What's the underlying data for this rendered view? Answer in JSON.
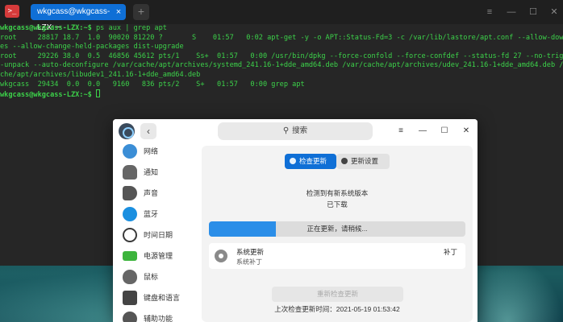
{
  "terminal": {
    "app_icon": "terminal-icon",
    "tab_title": "wkgcass@wkgcass-LZX: ~",
    "tab_close": "×",
    "new_tab": "+",
    "controls": [
      "≡",
      "—",
      "☐",
      "✕"
    ],
    "lines": [
      {
        "prompt": "wkgcass@wkgcass-LZX:~$",
        "text": " ps aux | grep apt"
      },
      {
        "prompt": "",
        "text": "root     28817 18.7  1.0  90020 81220 ?       S    01:57   0:02 apt-get -y -o APT::Status-Fd=3 -c /var/lib/lastore/apt.conf --allow-downgrad"
      },
      {
        "prompt": "",
        "text": "es --allow-change-held-packages dist-upgrade"
      },
      {
        "prompt": "",
        "text": "root     29226 38.0  0.5  46856 45612 pts/1    Ss+  01:57   0:00 /usr/bin/dpkg --force-confold --force-confdef --status-fd 27 --no-triggers -"
      },
      {
        "prompt": "",
        "text": "-unpack --auto-deconfigure /var/cache/apt/archives/systemd_241.16-1+dde_amd64.deb /var/cache/apt/archives/udev_241.16-1+dde_amd64.deb /var/ca"
      },
      {
        "prompt": "",
        "text": "che/apt/archives/libudev1_241.16-1+dde_amd64.deb"
      },
      {
        "prompt": "",
        "text": "wkgcass  29434  0.0  0.0   9160   836 pts/2    S+   01:57   0:00 grep apt"
      },
      {
        "prompt": "wkgcass@wkgcass-LZX:~$",
        "text": " "
      }
    ]
  },
  "control_center": {
    "logo": "deepin-logo-icon",
    "back": "‹",
    "search_placeholder": "搜索",
    "controls": [
      "≡",
      "—",
      "☐",
      "✕"
    ],
    "sidebar": {
      "items": [
        {
          "label": "网络",
          "icon": "network-icon",
          "color": "#3b8ed6"
        },
        {
          "label": "通知",
          "icon": "bell-icon",
          "color": "#666666"
        },
        {
          "label": "声音",
          "icon": "speaker-icon",
          "color": "#555555"
        },
        {
          "label": "蓝牙",
          "icon": "bluetooth-icon",
          "color": "#1a8fe0"
        },
        {
          "label": "时间日期",
          "icon": "clock-icon",
          "color": "#3a3a3a"
        },
        {
          "label": "电源管理",
          "icon": "battery-icon",
          "color": "#3cb43c"
        },
        {
          "label": "鼠标",
          "icon": "mouse-icon",
          "color": "#666666"
        },
        {
          "label": "键盘和语言",
          "icon": "keyboard-icon",
          "color": "#444444"
        },
        {
          "label": "辅助功能",
          "icon": "accessibility-icon",
          "color": "#555555"
        }
      ]
    },
    "update": {
      "tab_check": "检查更新",
      "tab_settings": "更新设置",
      "status_detected": "检测到有新系统版本",
      "status_downloaded": "已下载",
      "progress_label": "正在更新，请稍候...",
      "progress_fraction": 0.26,
      "item_title": "系统更新",
      "item_subtitle": "系统补丁",
      "item_right": "补丁",
      "recheck_label": "重新检查更新",
      "last_check": "上次检查更新时间：2021-05-19 01:53:42"
    }
  },
  "colors": {
    "accent": "#0f6fd6",
    "terminal_text": "#3cd24a",
    "progress": "#2b8ee8"
  }
}
